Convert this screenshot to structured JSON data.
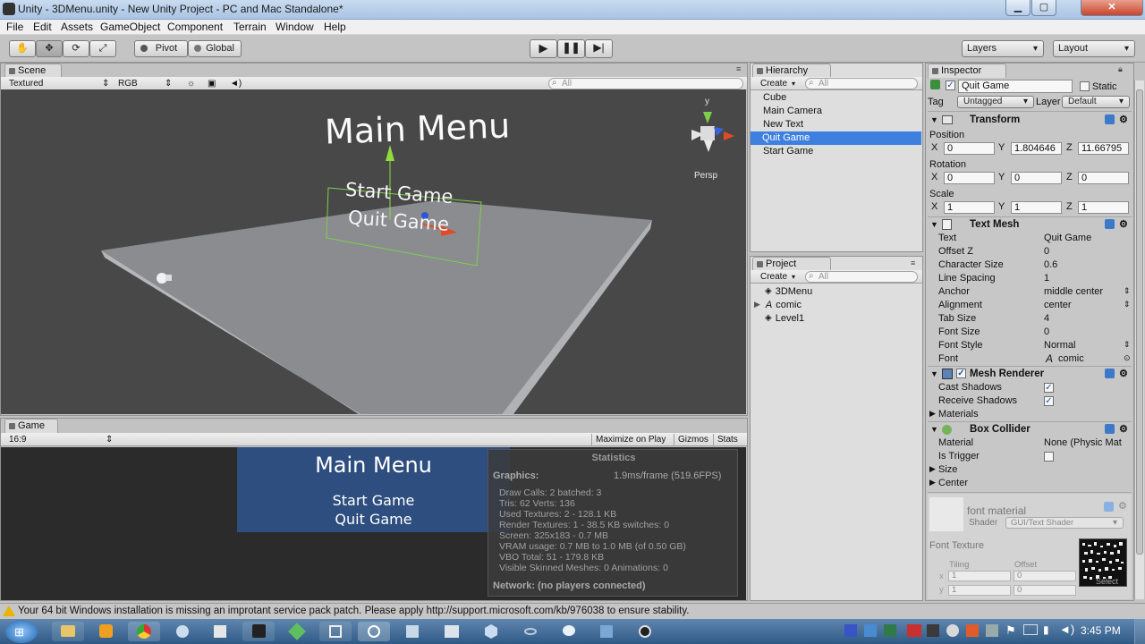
{
  "window": {
    "title": "Unity - 3DMenu.unity - New Unity Project - PC and Mac Standalone*",
    "min": "▁",
    "max": "▢",
    "close": "✕"
  },
  "menu": [
    "File",
    "Edit",
    "Assets",
    "GameObject",
    "Component",
    "Terrain",
    "Window",
    "Help"
  ],
  "toolbar": {
    "pivot": "Pivot",
    "global": "Global",
    "layers": "Layers",
    "layout": "Layout"
  },
  "scene": {
    "tab": "Scene",
    "render_mode": "Textured",
    "color_mode": "RGB",
    "search": "All",
    "persp": "Persp",
    "gizmo_y": "y",
    "text_main": "Main Menu",
    "text_start": "Start Game",
    "text_quit": "Quit Game"
  },
  "game": {
    "tab": "Game",
    "aspect": "16:9",
    "maximize": "Maximize on Play",
    "gizmos": "Gizmos",
    "stats": "Stats",
    "title": "Main Menu",
    "start": "Start Game",
    "quit": "Quit Game",
    "statistics": {
      "header": "Statistics",
      "graphics_label": "Graphics:",
      "graphics_value": "1.9ms/frame (519.6FPS)",
      "lines": [
        "Draw Calls: 2   batched: 3",
        "Tris: 62   Verts: 136",
        "Used Textures: 2 - 128.1 KB",
        "Render Textures: 1 - 38.5 KB    switches: 0",
        "Screen: 325x183 - 0.7 MB",
        "VRAM usage: 0.7 MB to 1.0 MB (of 0.50 GB)",
        "VBO Total: 51 - 179.8 KB",
        "Visible Skinned Meshes: 0     Animations: 0"
      ],
      "network": "Network: (no players connected)"
    }
  },
  "hierarchy": {
    "tab": "Hierarchy",
    "create": "Create",
    "search": "All",
    "items": [
      "Cube",
      "Main Camera",
      "New Text",
      "Quit Game",
      "Start Game"
    ],
    "selected_index": 3
  },
  "project": {
    "tab": "Project",
    "create": "Create",
    "search": "All",
    "items": [
      "3DMenu",
      "comic",
      "Level1"
    ]
  },
  "inspector": {
    "tab": "Inspector",
    "object_name": "Quit Game",
    "static": "Static",
    "tag_label": "Tag",
    "tag_value": "Untagged",
    "layer_label": "Layer",
    "layer_value": "Default",
    "transform": {
      "title": "Transform",
      "position_label": "Position",
      "position": {
        "x": "0",
        "y": "1.804646",
        "z": "11.66795"
      },
      "rotation_label": "Rotation",
      "rotation": {
        "x": "0",
        "y": "0",
        "z": "0"
      },
      "scale_label": "Scale",
      "scale": {
        "x": "1",
        "y": "1",
        "z": "1"
      }
    },
    "text_mesh": {
      "title": "Text Mesh",
      "props": [
        {
          "label": "Text",
          "value": "Quit Game"
        },
        {
          "label": "Offset Z",
          "value": "0"
        },
        {
          "label": "Character Size",
          "value": "0.6"
        },
        {
          "label": "Line Spacing",
          "value": "1"
        },
        {
          "label": "Anchor",
          "value": "middle center"
        },
        {
          "label": "Alignment",
          "value": "center"
        },
        {
          "label": "Tab Size",
          "value": "4"
        },
        {
          "label": "Font Size",
          "value": "0"
        },
        {
          "label": "Font Style",
          "value": "Normal"
        },
        {
          "label": "Font",
          "value": "comic"
        }
      ]
    },
    "mesh_renderer": {
      "title": "Mesh Renderer",
      "cast_shadows": "Cast Shadows",
      "receive_shadows": "Receive Shadows",
      "materials": "Materials"
    },
    "box_collider": {
      "title": "Box Collider",
      "material_label": "Material",
      "material_value": "None (Physic Mat",
      "is_trigger": "Is Trigger",
      "size": "Size",
      "center": "Center"
    },
    "material": {
      "name": "font material",
      "shader_label": "Shader",
      "shader_value": "GUI/Text Shader",
      "font_texture": "Font Texture",
      "tiling": "Tiling",
      "offset": "Offset",
      "tx": "1",
      "ty": "1",
      "ox": "0",
      "oy": "0",
      "select": "Select"
    }
  },
  "status": {
    "message": "Your 64 bit Windows installation is missing an improtant service pack patch. Please apply http://support.microsoft.com/kb/976038 to ensure stability."
  },
  "taskbar": {
    "time": "3:45 PM"
  }
}
